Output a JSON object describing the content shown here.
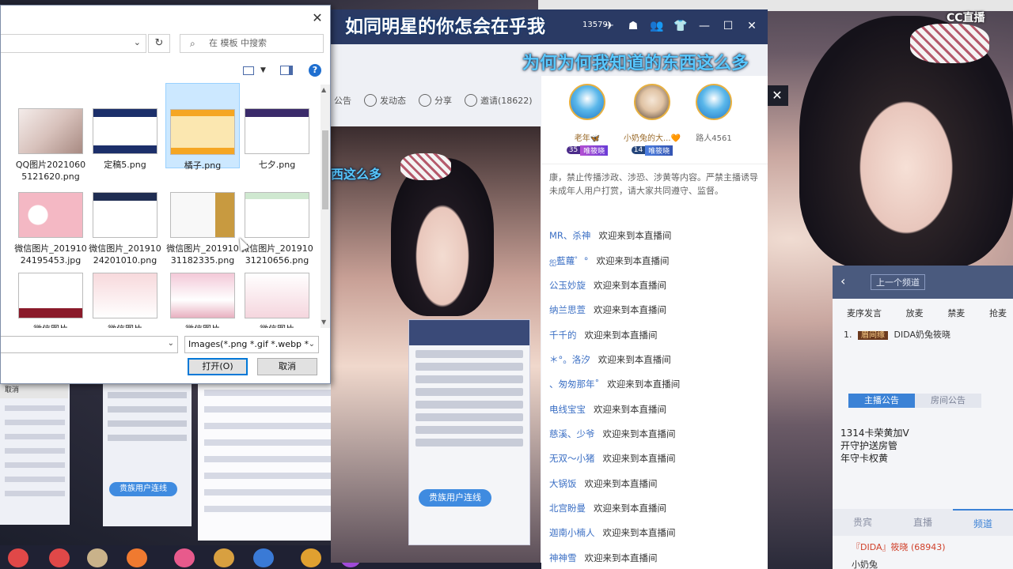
{
  "overlay": {
    "lyric_top": "如同明星的你怎会在乎我",
    "lyric_bottom": "为何为何我知道的东西这么多",
    "lyric_mini": "西这么多",
    "brand": "CC直播"
  },
  "mid_stream": {
    "viewer_count": "13579",
    "toolbar": [
      {
        "label": "公告"
      },
      {
        "label": "发动态"
      },
      {
        "label": "分享"
      },
      {
        "label": "邀请(18622)"
      }
    ]
  },
  "chat": {
    "top_fans": [
      {
        "name": "老年🦋",
        "level": "35",
        "tag": "唯筱晓"
      },
      {
        "name": "小奶兔的大...🧡",
        "level": "14",
        "tag": "唯筱晓"
      },
      {
        "name": "路人4561"
      }
    ],
    "notice": "康，禁止传播涉政、涉恐、涉黄等内容。严禁主播诱导未成年人用户打赏，请大家共同遵守、监督。",
    "welcome_text": "欢迎来到本直播间",
    "messages": [
      {
        "user": "MR、杀神"
      },
      {
        "user": "ஐ藍蘿゜°"
      },
      {
        "user": "公玉妙旋"
      },
      {
        "user": "纳兰思萱"
      },
      {
        "user": "千千的"
      },
      {
        "user": "＊°。洛汐"
      },
      {
        "user": "、匆匆那年˚"
      },
      {
        "user": "电线宝宝"
      },
      {
        "user": "慈溪、少爷"
      },
      {
        "user": "无双～小猪"
      },
      {
        "user": "大锅饭"
      },
      {
        "user": "北宫盼曼"
      },
      {
        "user": "迦南小楠人"
      },
      {
        "user": "神神雪"
      }
    ]
  },
  "right_panel": {
    "prev_channel": "上一个频道",
    "ops": [
      "麦序发言",
      "放麦",
      "禁麦",
      "抢麦"
    ],
    "user_line": {
      "num": "1.",
      "tag": "眉间缘",
      "name": "DIDA奶兔筱晓"
    },
    "tabs": [
      "主播公告",
      "房间公告"
    ],
    "notice_lines": [
      "1314卡荣黄加V",
      "开守护送房管",
      "年守卡权黄"
    ],
    "bottom_tabs": [
      "贵宾",
      "直播",
      "频道"
    ],
    "line1": "『DIDA』筱晓 (68943)",
    "line2": "小奶兔"
  },
  "mini_screens": {
    "pill_text": "贵族用户连线",
    "mini_b_pill": "贵族用户连线",
    "back_cancel": "取消"
  },
  "dialog": {
    "search_placeholder": "在 模板 中搜索",
    "files": [
      {
        "name": "QQ图片20210605121620.png",
        "thumb": "photo"
      },
      {
        "name": "定稿5.png",
        "thumb": "frame-blue"
      },
      {
        "name": "橘子.png",
        "thumb": "frame-orange",
        "selected": true
      },
      {
        "name": "七夕.png",
        "thumb": "frame-purple"
      },
      {
        "name": "微信图片_20191024195453.jpg",
        "thumb": "pink"
      },
      {
        "name": "微信图片_20191024201010.png",
        "thumb": "frame-dark"
      },
      {
        "name": "微信图片_20191031182335.png",
        "thumb": "frame-gold"
      },
      {
        "name": "微信图片_20191031210656.png",
        "thumb": "frame-green"
      },
      {
        "name": "微信图片",
        "thumb": "frame-red"
      },
      {
        "name": "微信图片",
        "thumb": "floral"
      },
      {
        "name": "微信图片",
        "thumb": "floral2"
      },
      {
        "name": "微信图片",
        "thumb": "floral3"
      }
    ],
    "file_type": "Images(*.png *.gif *.webp *.j",
    "open_label": "打开(O)",
    "cancel_label": "取消"
  },
  "colors": {
    "title_bar": "#2a3a64",
    "link_blue": "#3b6fc4",
    "accent": "#3b82d6",
    "dialog_selection": "#cce8ff"
  }
}
